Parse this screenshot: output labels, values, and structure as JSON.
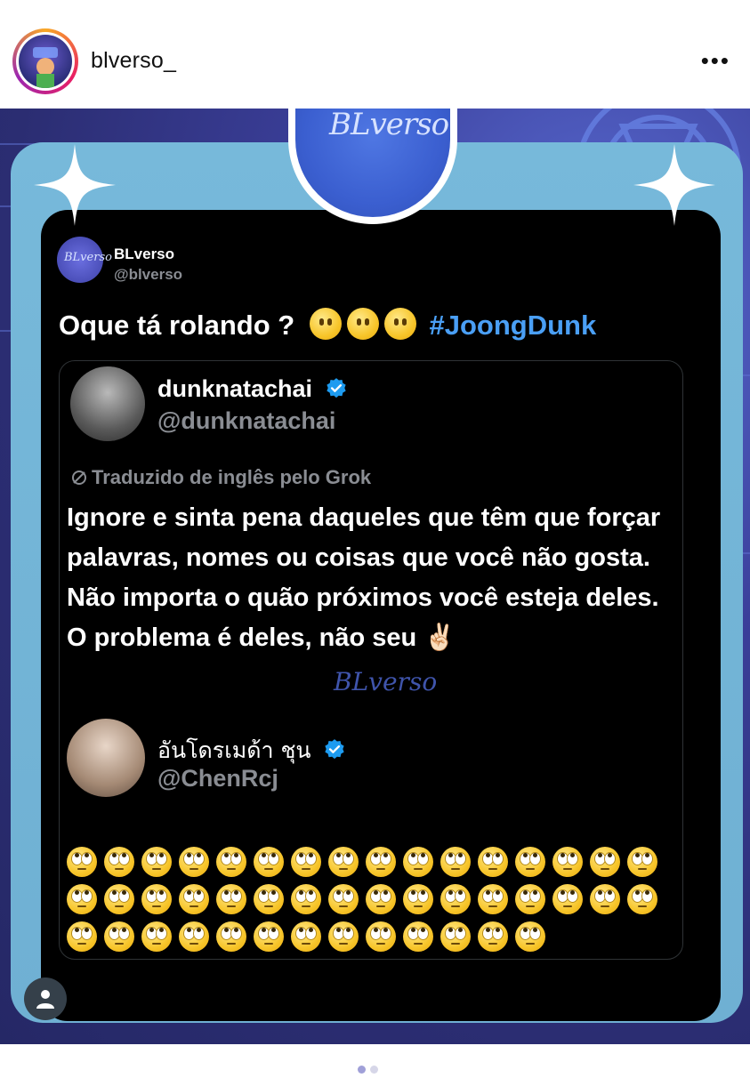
{
  "header": {
    "username": "blverso_",
    "more_label": "•••"
  },
  "post": {
    "logo_text": "BLverso",
    "tweet": {
      "avatar_text": "BLverso",
      "author_name": "BLverso",
      "author_handle": "@blverso",
      "text_prefix": "Oque tá rolando ?",
      "hashtag": "#JoongDunk",
      "emoji_count": 3,
      "emoji_name": "face-without-mouth"
    },
    "quoted": {
      "name": "dunknatachai",
      "handle": "@dunknatachai",
      "translated_label": "Traduzido de inglês pelo Grok",
      "body": "Ignore e sinta pena daqueles que têm que forçar palavras, nomes ou coisas que você não gosta. Não importa o quão próximos você esteja deles. O problema é deles, não seu ✌🏻",
      "watermark": "BLverso"
    },
    "reply": {
      "name": "อันโดรเมด้า ชุน",
      "handle": "@ChenRcj",
      "emoji_name": "face-with-rolling-eyes",
      "rows": [
        16,
        16,
        13
      ]
    }
  },
  "colors": {
    "accent_blue": "#4a9ff5",
    "verified_blue": "#1d9bf0",
    "card_bg": "#000000",
    "frame": "#77b9da"
  },
  "icons": {
    "more": "more-horizontal-icon",
    "verified": "verified-badge-icon",
    "translate": "translate-slash-icon",
    "user": "user-icon",
    "sparkle": "sparkle-icon"
  }
}
